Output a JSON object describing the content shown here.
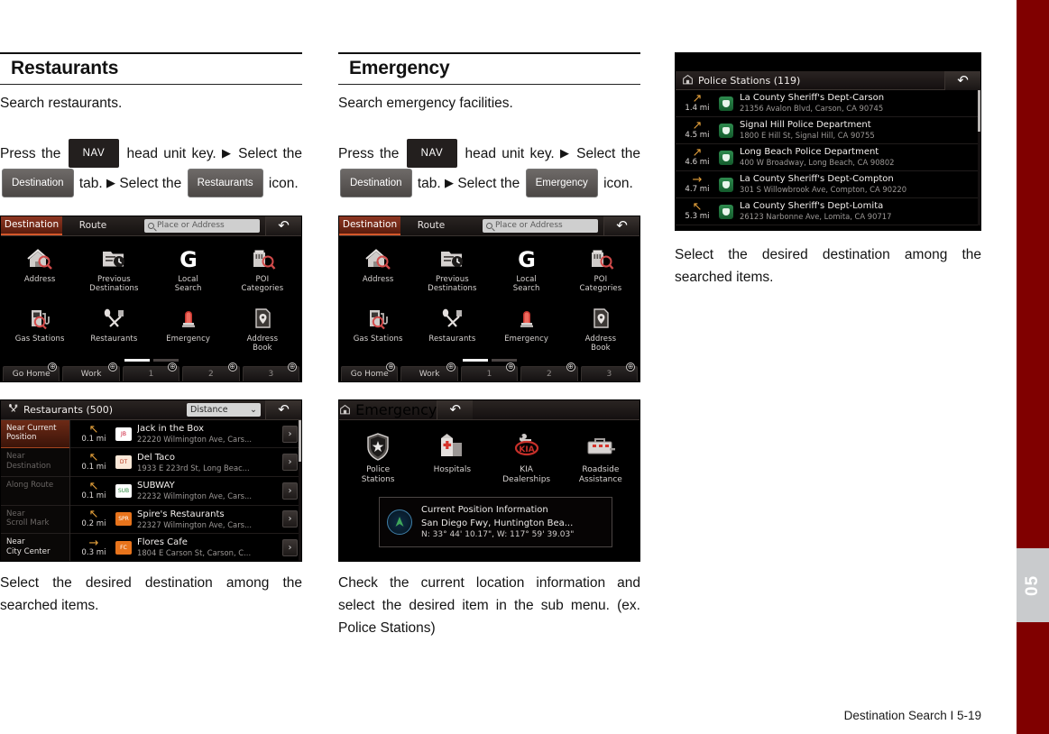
{
  "page": {
    "footer": "Destination Search I 5-19",
    "chapter_number": "05",
    "accent_red": "#800000"
  },
  "col1": {
    "title": "Restaurants",
    "subtitle": "Search restaurants.",
    "instruction": {
      "p1": "Press the",
      "key_nav": "NAV",
      "p2": "head unit key.",
      "arrow": "▶",
      "p3": "Select the",
      "key_tab": "Destination",
      "p4": "tab.",
      "p5": "Select the",
      "key_icon": "Restaurants",
      "p6": "icon."
    },
    "caption": "Select the desired destination among the searched items."
  },
  "col2": {
    "title": "Emergency",
    "subtitle": "Search emergency facilities.",
    "instruction": {
      "p1": "Press the",
      "key_nav": "NAV",
      "p2": "head unit key.",
      "arrow": "▶",
      "p3": "Select the",
      "key_tab": "Destination",
      "p4": "tab.",
      "p5": "Select the",
      "key_icon": "Emergency",
      "p6": "icon."
    },
    "caption": "Check the current location information and select the desired item in the sub menu. (ex. Police Stations)"
  },
  "col3": {
    "caption": "Select the desired destination among the searched items."
  },
  "nav_screen": {
    "tabs": [
      {
        "label": "Destination",
        "active": true
      },
      {
        "label": "Route",
        "active": false
      }
    ],
    "search_placeholder": "Place or Address",
    "back_icon": "↶",
    "grid": [
      {
        "label": "Address",
        "icon": "house-search-icon"
      },
      {
        "label": "Previous\nDestinations",
        "icon": "history-folder-icon"
      },
      {
        "label": "Local\nSearch",
        "icon": "google-g-icon"
      },
      {
        "label": "POI\nCategories",
        "icon": "building-search-icon"
      },
      {
        "label": "Gas Stations",
        "icon": "fuel-pump-icon"
      },
      {
        "label": "Restaurants",
        "icon": "fork-spoon-icon"
      },
      {
        "label": "Emergency",
        "icon": "siren-light-icon"
      },
      {
        "label": "Address\nBook",
        "icon": "address-book-pin-icon"
      }
    ],
    "page_indicator": {
      "pages": 2,
      "current": 1
    },
    "shortcuts": [
      {
        "label": "Go Home",
        "dim": false
      },
      {
        "label": "Work",
        "dim": false
      },
      {
        "label": "1",
        "dim": true
      },
      {
        "label": "2",
        "dim": true
      },
      {
        "label": "3",
        "dim": true
      }
    ],
    "shortcut_add": "⊕"
  },
  "restaurant_list": {
    "header_icon": "fork-spoon-icon",
    "header_title": "Restaurants (500)",
    "sort_value": "Distance",
    "sort_caret": "⌄",
    "back_icon": "↶",
    "categories": [
      {
        "label": "Near Current\nPosition",
        "state": "active"
      },
      {
        "label": "Near\nDestination",
        "state": "disabled"
      },
      {
        "label": "Along Route",
        "state": "disabled"
      },
      {
        "label": "Near\nScroll Mark",
        "state": "disabled"
      },
      {
        "label": "Near\nCity Center",
        "state": "enabled"
      }
    ],
    "items": [
      {
        "distance": "0.1 mi",
        "arrow": "↖",
        "name": "Jack in the Box",
        "address": "22220 Wilmington Ave, Cars...",
        "brand_color": "#ffffff",
        "brand_text": "JB",
        "brand_fg": "#c8102e"
      },
      {
        "distance": "0.1 mi",
        "arrow": "↖",
        "name": "Del Taco",
        "address": "1933 E 223rd St, Long Beac...",
        "brand_color": "#fbe8d8",
        "brand_text": "DT",
        "brand_fg": "#b5321a"
      },
      {
        "distance": "0.1 mi",
        "arrow": "↖",
        "name": "SUBWAY",
        "address": "22232 Wilmington Ave, Cars...",
        "brand_color": "#ffffff",
        "brand_text": "SUB",
        "brand_fg": "#2b8a3e"
      },
      {
        "distance": "0.2 mi",
        "arrow": "↖",
        "name": "Spire's Restaurants",
        "address": "22327 Wilmington Ave, Cars...",
        "brand_color": "#e8741c",
        "brand_text": "SPR",
        "brand_fg": "#ffffff"
      },
      {
        "distance": "0.3 mi",
        "arrow": "→",
        "name": "Flores Cafe",
        "address": "1804 E Carson St, Carson, C...",
        "brand_color": "#e8741c",
        "brand_text": "FC",
        "brand_fg": "#ffffff"
      }
    ],
    "chevron": "›"
  },
  "emergency_screen": {
    "header_icon": "emergency-building-icon",
    "header_title": "Emergency",
    "back_icon": "↶",
    "items": [
      {
        "label": "Police\nStations",
        "icon": "police-badge-icon"
      },
      {
        "label": "Hospitals",
        "icon": "hospital-icon"
      },
      {
        "label": "KIA\nDealerships",
        "icon": "kia-logo-icon"
      },
      {
        "label": "Roadside\nAssistance",
        "icon": "toolbox-icon"
      }
    ],
    "current_position": {
      "title": "Current Position Information",
      "address": "San Diego Fwy, Huntington Bea...",
      "coords": "N: 33° 44' 10.17\", W: 117° 59' 39.03\"",
      "icon": "compass-arrow-icon"
    }
  },
  "police_list": {
    "header_icon": "emergency-building-icon",
    "header_title": "Police Stations (119)",
    "back_icon": "↶",
    "items": [
      {
        "distance": "1.4 mi",
        "arrow": "↗",
        "name": "La County Sheriff's Dept-Carson",
        "address": "21356 Avalon Blvd, Carson, CA 90745"
      },
      {
        "distance": "4.5 mi",
        "arrow": "↗",
        "name": "Signal Hill Police Department",
        "address": "1800 E Hill St, Signal Hill, CA 90755"
      },
      {
        "distance": "4.6 mi",
        "arrow": "↗",
        "name": "Long Beach Police Department",
        "address": "400 W Broadway, Long Beach, CA 90802"
      },
      {
        "distance": "4.7 mi",
        "arrow": "→",
        "name": "La County Sheriff's Dept-Compton",
        "address": "301 S Willowbrook Ave, Compton, CA 90220"
      },
      {
        "distance": "5.3 mi",
        "arrow": "↖",
        "name": "La County Sheriff's Dept-Lomita",
        "address": "26123 Narbonne Ave, Lomita, CA 90717"
      }
    ]
  }
}
